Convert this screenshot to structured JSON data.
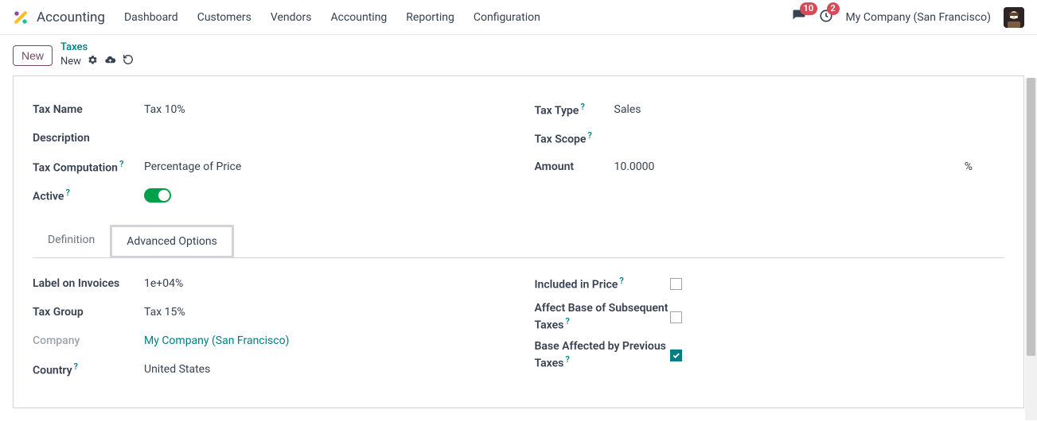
{
  "header": {
    "module": "Accounting",
    "menu": [
      "Dashboard",
      "Customers",
      "Vendors",
      "Accounting",
      "Reporting",
      "Configuration"
    ],
    "messages_badge": "10",
    "activities_badge": "2",
    "company": "My Company (San Francisco)"
  },
  "controlbar": {
    "new_button": "New",
    "breadcrumb_parent": "Taxes",
    "breadcrumb_current": "New"
  },
  "form": {
    "tax_name_label": "Tax Name",
    "tax_name_value": "Tax 10%",
    "description_label": "Description",
    "tax_computation_label": "Tax Computation",
    "tax_computation_value": "Percentage of Price",
    "active_label": "Active",
    "tax_type_label": "Tax Type",
    "tax_type_value": "Sales",
    "tax_scope_label": "Tax Scope",
    "amount_label": "Amount",
    "amount_value": "10.0000",
    "amount_unit": "%"
  },
  "tabs": {
    "definition": "Definition",
    "advanced": "Advanced Options"
  },
  "advanced": {
    "label_on_invoices_label": "Label on Invoices",
    "label_on_invoices_value": "1e+04%",
    "tax_group_label": "Tax Group",
    "tax_group_value": "Tax 15%",
    "company_label": "Company",
    "company_value": "My Company (San Francisco)",
    "country_label": "Country",
    "country_value": "United States",
    "included_in_price_label": "Included in Price",
    "affect_base_label": "Affect Base of Subsequent Taxes",
    "base_affected_label": "Base Affected by Previous Taxes"
  }
}
